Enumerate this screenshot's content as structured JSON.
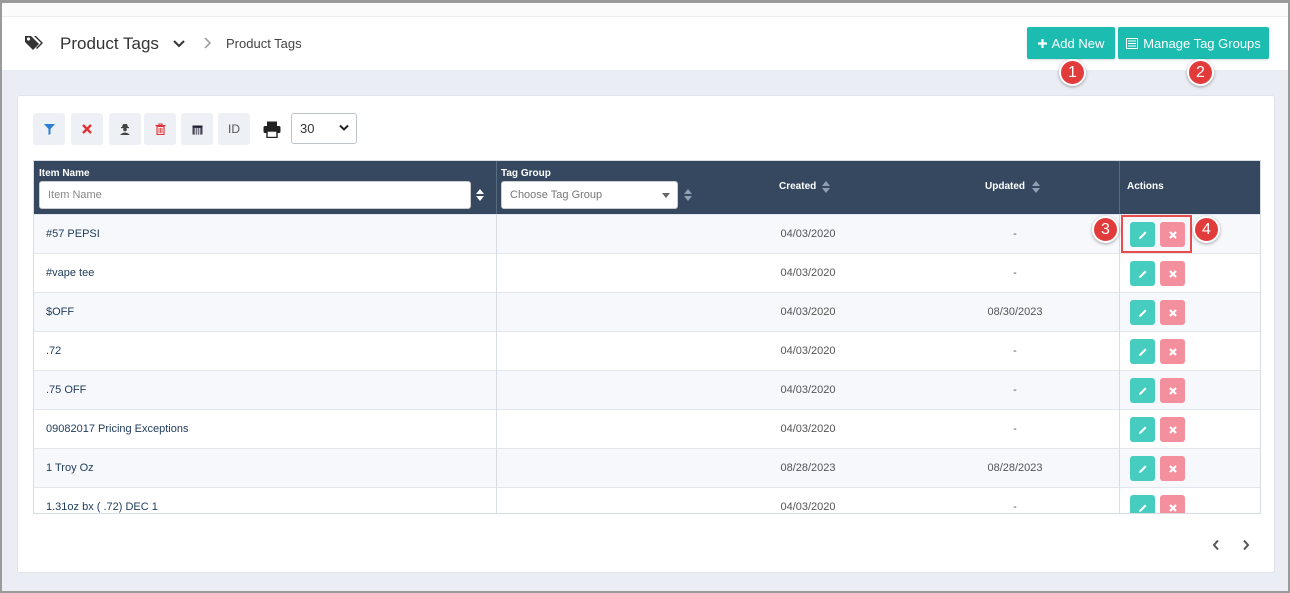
{
  "header": {
    "title": "Product Tags",
    "breadcrumb": "Product Tags",
    "add_new_label": "Add New",
    "manage_tag_groups_label": "Manage Tag Groups"
  },
  "callouts": [
    "1",
    "2",
    "3",
    "4"
  ],
  "toolbar": {
    "id_label": "ID",
    "page_size": "30"
  },
  "table": {
    "columns": {
      "item_name": "Item Name",
      "tag_group": "Tag Group",
      "created": "Created",
      "updated": "Updated",
      "actions": "Actions"
    },
    "filters": {
      "item_name_placeholder": "Item Name",
      "tag_group_placeholder": "Choose Tag Group"
    },
    "rows": [
      {
        "name": "#57 PEPSI",
        "tag_group": "",
        "created": "04/03/2020",
        "updated": "-"
      },
      {
        "name": "#vape tee",
        "tag_group": "",
        "created": "04/03/2020",
        "updated": "-"
      },
      {
        "name": "$OFF",
        "tag_group": "",
        "created": "04/03/2020",
        "updated": "08/30/2023"
      },
      {
        "name": ".72",
        "tag_group": "",
        "created": "04/03/2020",
        "updated": "-"
      },
      {
        "name": ".75 OFF",
        "tag_group": "",
        "created": "04/03/2020",
        "updated": "-"
      },
      {
        "name": "09082017 Pricing Exceptions",
        "tag_group": "",
        "created": "04/03/2020",
        "updated": "-"
      },
      {
        "name": "1 Troy Oz",
        "tag_group": "",
        "created": "08/28/2023",
        "updated": "08/28/2023"
      },
      {
        "name": "1.31oz bx ( .72) DEC 1",
        "tag_group": "",
        "created": "04/03/2020",
        "updated": "-"
      }
    ]
  },
  "colors": {
    "teal": "#1dbcb0",
    "header_dark": "#35485f",
    "edit": "#46cdc0",
    "delete": "#f4909d",
    "callout": "#e23b3b"
  },
  "icons": {
    "title": "tags-icon",
    "filter": "filter-icon",
    "clear": "x-icon",
    "user": "user-secret-icon",
    "trash": "trash-icon",
    "calendar": "calendar-icon",
    "print": "print-icon",
    "edit": "pencil-icon",
    "delete": "times-icon"
  }
}
